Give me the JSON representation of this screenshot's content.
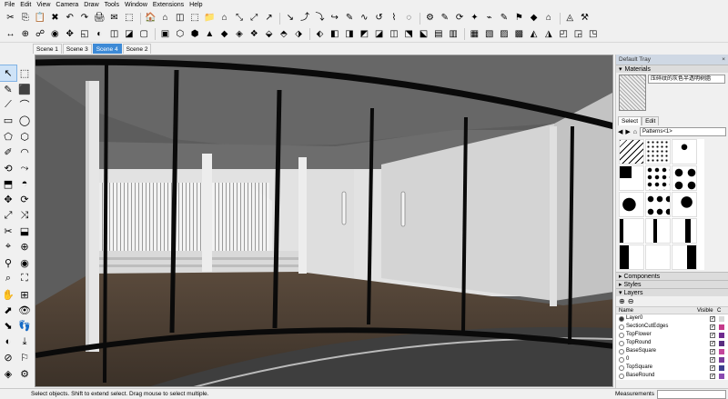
{
  "menu": [
    "File",
    "Edit",
    "View",
    "Camera",
    "Draw",
    "Tools",
    "Window",
    "Extensions",
    "Help"
  ],
  "toolbar1": [
    "✂",
    "⎘",
    "📋",
    "✖",
    "↶",
    "↷",
    "🖨",
    "✉",
    "⬚",
    "🏠",
    "⌂",
    "◫",
    "⬚",
    "📁",
    "⌂",
    "⤡",
    "⤢",
    "↗",
    "↘",
    "⤴",
    "⤵",
    "↪",
    "✎",
    "∿",
    "↺",
    "⌇",
    "◌",
    "⚙",
    "✎",
    "⟳",
    "✦",
    "⌁",
    "✎",
    "⚑",
    "◆",
    "⌂",
    "◬",
    "⚒"
  ],
  "toolbar2": [
    "↔",
    "⊕",
    "☍",
    "◉",
    "✥",
    "◱",
    "◐",
    "◫",
    "◪",
    "▢",
    "▣",
    "⬡",
    "⬢",
    "▲",
    "◆",
    "◈",
    "❖",
    "⬙",
    "⬘",
    "⬗",
    "⬖",
    "◧",
    "◨",
    "◩",
    "◪",
    "◫",
    "⬔",
    "⬕",
    "▤",
    "▥",
    "▦",
    "▧",
    "▨",
    "▩",
    "◭",
    "◮",
    "◰",
    "◲",
    "◳"
  ],
  "scenes": [
    "Scene 1",
    "Scene 3",
    "Scene 4",
    "Scene 2"
  ],
  "active_scene": "Scene 4",
  "palette": [
    "↖",
    "⬚",
    "✎",
    "⬛",
    "⟋",
    "⌒",
    "▭",
    "◯",
    "⬠",
    "⬡",
    "✐",
    "◠",
    "⟲",
    "⤳",
    "⬒",
    "◓",
    "✥",
    "⟳",
    "⤢",
    "⤨",
    "✂",
    "⬓",
    "⌖",
    "⊕",
    "⚲",
    "◉",
    "⌕",
    "⛶",
    "✋",
    "⊞",
    "⬈",
    "👁",
    "⬊",
    "👣",
    "◐",
    "⤓",
    "⊘",
    "⚐",
    "◈",
    "⚙"
  ],
  "tray": {
    "title": "Default Tray",
    "materials_header": "Materials",
    "material_name": "压碎纹的灰色半透明树脂",
    "tab_select": "Select",
    "tab_edit": "Edit",
    "library": "Patterns<1>",
    "components": "Components",
    "styles": "Styles",
    "layers": "Layers",
    "col_name": "Name",
    "col_visible": "Visible",
    "col_color": "C"
  },
  "layers": [
    {
      "name": "Layer0",
      "active": true,
      "color": "#d9d9d9"
    },
    {
      "name": "SectionCutEdges",
      "active": false,
      "color": "#c53a8a"
    },
    {
      "name": "TopFlower",
      "active": false,
      "color": "#6f2b8f"
    },
    {
      "name": "TopRound",
      "active": false,
      "color": "#5a2d80"
    },
    {
      "name": "BaseSquare",
      "active": false,
      "color": "#c4469b"
    },
    {
      "name": "0",
      "active": false,
      "color": "#7a3a9a"
    },
    {
      "name": "TopSquare",
      "active": false,
      "color": "#3f3f8f"
    },
    {
      "name": "BaseRound",
      "active": false,
      "color": "#8a4ab0"
    }
  ],
  "status": {
    "hint": "Select objects. Shift to extend select. Drag mouse to select multiple.",
    "measurements": "Measurements"
  }
}
